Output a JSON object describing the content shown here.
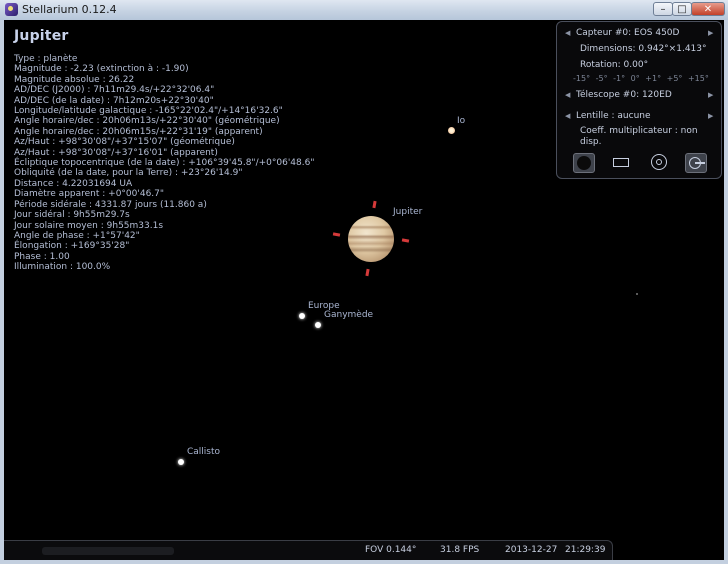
{
  "window": {
    "title": "Stellarium 0.12.4"
  },
  "object_info": {
    "name": "Jupiter",
    "lines": [
      "Type : planète",
      "Magnitude : -2.23 (extinction à : -1.90)",
      "Magnitude absolue : 26.22",
      "AD/DEC (J2000) : 7h11m29.4s/+22°32'06.4\"",
      "AD/DEC (de la date) : 7h12m20s+22°30'40\"",
      "Longitude/latitude galactique : -165°22'02.4\"/+14°16'32.6\"",
      "Angle horaire/dec : 20h06m13s/+22°30'40\" (géométrique)",
      "Angle horaire/dec : 20h06m15s/+22°31'19\" (apparent)",
      "Az/Haut : +98°30'08\"/+37°15'07\" (géométrique)",
      "Az/Haut : +98°30'08\"/+37°16'01\" (apparent)",
      "Écliptique topocentrique (de la date) : +106°39'45.8\"/+0°06'48.6\"",
      "Obliquité (de la date, pour la Terre) : +23°26'14.9\"",
      "Distance : 4.22031694 UA",
      "Diamètre apparent : +0°00'46.7\"",
      "Période sidérale : 4331.87 jours (11.860 a)",
      "Jour sidéral : 9h55m29.7s",
      "Jour solaire moyen : 9h55m33.1s",
      "Angle de phase : +1°57'42\"",
      "Élongation : +169°35'28\"",
      "Phase : 1.00",
      "Illumination : 100.0%"
    ]
  },
  "sky_labels": {
    "jupiter": "Jupiter",
    "io": "Io",
    "europe": "Europe",
    "ganymede": "Ganymède",
    "callisto": "Callisto"
  },
  "oculars_panel": {
    "sensor": "Capteur #0: EOS 450D",
    "dimensions": "Dimensions: 0.942°×1.413°",
    "rotation": "Rotation: 0.00°",
    "rotation_steps": "-15° -5° -1° 0° +1° +5° +15°",
    "telescope": "Télescope #0: 120ED",
    "lens": "Lentille : aucune",
    "coeff": "Coeff. multiplicateur : non",
    "coeff2": "disp."
  },
  "status_bar": {
    "fov": "FOV 0.144°",
    "fps": "31.8 FPS",
    "date": "2013-12-27",
    "time": "21:29:39"
  },
  "colors": {
    "info_text": "#b5bfd6",
    "reticle": "#d63a3a",
    "panel_bg": "#0a0a0c"
  }
}
